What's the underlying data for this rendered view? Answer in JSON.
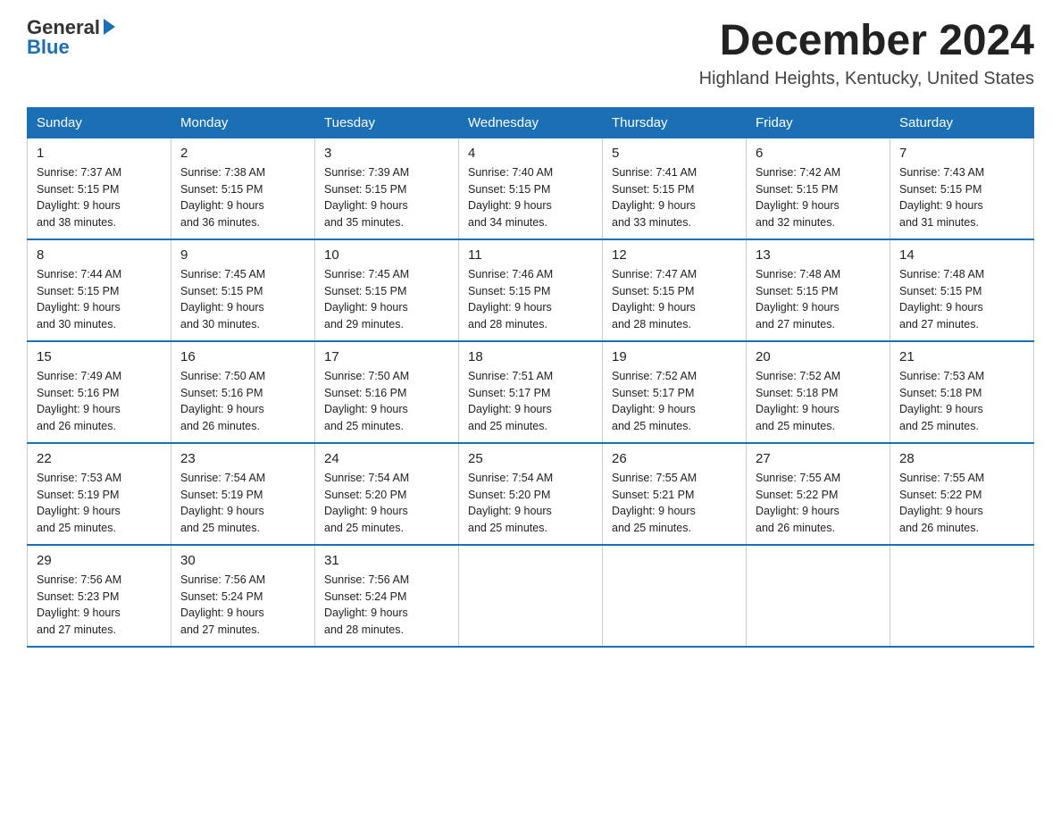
{
  "header": {
    "logo_text_general": "General",
    "logo_text_blue": "Blue",
    "month_title": "December 2024",
    "location": "Highland Heights, Kentucky, United States"
  },
  "weekdays": [
    "Sunday",
    "Monday",
    "Tuesday",
    "Wednesday",
    "Thursday",
    "Friday",
    "Saturday"
  ],
  "weeks": [
    [
      {
        "day": "1",
        "sunrise": "7:37 AM",
        "sunset": "5:15 PM",
        "daylight": "9 hours and 38 minutes."
      },
      {
        "day": "2",
        "sunrise": "7:38 AM",
        "sunset": "5:15 PM",
        "daylight": "9 hours and 36 minutes."
      },
      {
        "day": "3",
        "sunrise": "7:39 AM",
        "sunset": "5:15 PM",
        "daylight": "9 hours and 35 minutes."
      },
      {
        "day": "4",
        "sunrise": "7:40 AM",
        "sunset": "5:15 PM",
        "daylight": "9 hours and 34 minutes."
      },
      {
        "day": "5",
        "sunrise": "7:41 AM",
        "sunset": "5:15 PM",
        "daylight": "9 hours and 33 minutes."
      },
      {
        "day": "6",
        "sunrise": "7:42 AM",
        "sunset": "5:15 PM",
        "daylight": "9 hours and 32 minutes."
      },
      {
        "day": "7",
        "sunrise": "7:43 AM",
        "sunset": "5:15 PM",
        "daylight": "9 hours and 31 minutes."
      }
    ],
    [
      {
        "day": "8",
        "sunrise": "7:44 AM",
        "sunset": "5:15 PM",
        "daylight": "9 hours and 30 minutes."
      },
      {
        "day": "9",
        "sunrise": "7:45 AM",
        "sunset": "5:15 PM",
        "daylight": "9 hours and 30 minutes."
      },
      {
        "day": "10",
        "sunrise": "7:45 AM",
        "sunset": "5:15 PM",
        "daylight": "9 hours and 29 minutes."
      },
      {
        "day": "11",
        "sunrise": "7:46 AM",
        "sunset": "5:15 PM",
        "daylight": "9 hours and 28 minutes."
      },
      {
        "day": "12",
        "sunrise": "7:47 AM",
        "sunset": "5:15 PM",
        "daylight": "9 hours and 28 minutes."
      },
      {
        "day": "13",
        "sunrise": "7:48 AM",
        "sunset": "5:15 PM",
        "daylight": "9 hours and 27 minutes."
      },
      {
        "day": "14",
        "sunrise": "7:48 AM",
        "sunset": "5:15 PM",
        "daylight": "9 hours and 27 minutes."
      }
    ],
    [
      {
        "day": "15",
        "sunrise": "7:49 AM",
        "sunset": "5:16 PM",
        "daylight": "9 hours and 26 minutes."
      },
      {
        "day": "16",
        "sunrise": "7:50 AM",
        "sunset": "5:16 PM",
        "daylight": "9 hours and 26 minutes."
      },
      {
        "day": "17",
        "sunrise": "7:50 AM",
        "sunset": "5:16 PM",
        "daylight": "9 hours and 25 minutes."
      },
      {
        "day": "18",
        "sunrise": "7:51 AM",
        "sunset": "5:17 PM",
        "daylight": "9 hours and 25 minutes."
      },
      {
        "day": "19",
        "sunrise": "7:52 AM",
        "sunset": "5:17 PM",
        "daylight": "9 hours and 25 minutes."
      },
      {
        "day": "20",
        "sunrise": "7:52 AM",
        "sunset": "5:18 PM",
        "daylight": "9 hours and 25 minutes."
      },
      {
        "day": "21",
        "sunrise": "7:53 AM",
        "sunset": "5:18 PM",
        "daylight": "9 hours and 25 minutes."
      }
    ],
    [
      {
        "day": "22",
        "sunrise": "7:53 AM",
        "sunset": "5:19 PM",
        "daylight": "9 hours and 25 minutes."
      },
      {
        "day": "23",
        "sunrise": "7:54 AM",
        "sunset": "5:19 PM",
        "daylight": "9 hours and 25 minutes."
      },
      {
        "day": "24",
        "sunrise": "7:54 AM",
        "sunset": "5:20 PM",
        "daylight": "9 hours and 25 minutes."
      },
      {
        "day": "25",
        "sunrise": "7:54 AM",
        "sunset": "5:20 PM",
        "daylight": "9 hours and 25 minutes."
      },
      {
        "day": "26",
        "sunrise": "7:55 AM",
        "sunset": "5:21 PM",
        "daylight": "9 hours and 25 minutes."
      },
      {
        "day": "27",
        "sunrise": "7:55 AM",
        "sunset": "5:22 PM",
        "daylight": "9 hours and 26 minutes."
      },
      {
        "day": "28",
        "sunrise": "7:55 AM",
        "sunset": "5:22 PM",
        "daylight": "9 hours and 26 minutes."
      }
    ],
    [
      {
        "day": "29",
        "sunrise": "7:56 AM",
        "sunset": "5:23 PM",
        "daylight": "9 hours and 27 minutes."
      },
      {
        "day": "30",
        "sunrise": "7:56 AM",
        "sunset": "5:24 PM",
        "daylight": "9 hours and 27 minutes."
      },
      {
        "day": "31",
        "sunrise": "7:56 AM",
        "sunset": "5:24 PM",
        "daylight": "9 hours and 28 minutes."
      },
      null,
      null,
      null,
      null
    ]
  ],
  "labels": {
    "sunrise": "Sunrise:",
    "sunset": "Sunset:",
    "daylight": "Daylight:"
  }
}
